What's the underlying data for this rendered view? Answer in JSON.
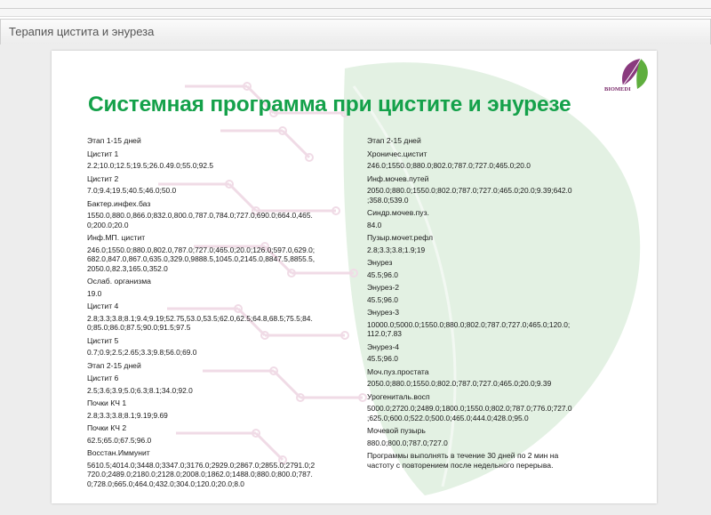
{
  "window": {
    "title": "Терапия цистита и энуреза"
  },
  "slide": {
    "brand": "BIOMEDI",
    "heading": "Системная программа при цистите и энурезе",
    "colors": {
      "heading": "#14a14a",
      "brand": "#7a2a6a",
      "leaf": "#e3f1e3",
      "circuit": "#f0dbe6"
    },
    "left_items": [
      {
        "label": "Этап 1-15 дней",
        "value": ""
      },
      {
        "label": "Цистит 1",
        "value": "2.2;10.0;12.5;19.5;26.0.49.0;55.0;92.5"
      },
      {
        "label": "Цистит 2",
        "value": "7.0;9.4;19.5;40.5;46.0;50.0"
      },
      {
        "label": "Бактер.инфех.баз",
        "value": "1550.0,880.0,866.0;832.0,800.0,787.0,784.0;727.0,690.0;664.0,465.\n0;200.0;20.0"
      },
      {
        "label": "Инф.МП. цистит",
        "value": "246.0;1550.0;880.0,802.0,787.0;727.0;465.0;20.0;126.0;597.0,629.0;\n682.0,847.0,867.0,635.0,329.0,9888.5,1045.0,2145.0,8847.5,8855.5,\n2050.0,82.3,165.0,352.0"
      },
      {
        "label": "Ослаб. организма",
        "value": "19.0"
      },
      {
        "label": "Цистит 4",
        "value": "2.8;3.3;3.8;8.1;9.4;9.19;52.75,53.0,53.5;62.0,62.5;64.8,68.5;75.5;84.\n0;85.0;86.0;87.5;90.0;91.5;97.5"
      },
      {
        "label": "Цистит 5",
        "value": "0.7;0.9;2.5;2.65;3.3;9.8;56.0;69.0"
      },
      {
        "label": "Этап 2-15 дней",
        "value": ""
      },
      {
        "label": "Цистит 6",
        "value": "2.5;3.6;3.9;5.0;6.3;8.1;34.0;92.0"
      },
      {
        "label": "Почки КЧ 1",
        "value": "2.8;3.3;3.8;8.1;9.19;9.69"
      },
      {
        "label": "Почки КЧ 2",
        "value": "62.5;65.0;67.5;96.0"
      },
      {
        "label": "Восстан.Иммунит",
        "value": "5610.5;4014.0;3448.0;3347.0;3176.0;2929.0;2867.0;2855.0;2791.0;2\n720.0;2489.0;2180.0;2128.0;2008.0;1862.0;1488.0;880.0;800.0;787.\n0;728.0;665.0;464.0;432.0;304.0;120.0;20.0;8.0"
      }
    ],
    "right_items": [
      {
        "label": "Этап 2-15 дней",
        "value": ""
      },
      {
        "label": "Хроничес.цистит",
        "value": "246.0;1550.0;880.0;802.0;787.0;727.0;465.0;20.0"
      },
      {
        "label": "Инф.мочев.путей",
        "value": "2050.0;880.0;1550.0;802.0;787.0;727.0;465.0;20.0;9.39;642.0\n;358.0;539.0"
      },
      {
        "label": "Синдр.мочев.пуз.",
        "value": "84.0"
      },
      {
        "label": "Пузыр.мочет.рефл",
        "value": "2.8;3.3;3.8;1.9;19"
      },
      {
        "label": "Энурез",
        "value": "45.5;96.0"
      },
      {
        "label": "Энурез-2",
        "value": "45.5;96.0"
      },
      {
        "label": "Энурез-3",
        "value": "10000.0;5000.0;1550.0;880.0;802.0;787.0;727.0;465.0;120.0;\n112.0;7.83"
      },
      {
        "label": "Энурез-4",
        "value": "45.5;96.0"
      },
      {
        "label": "Моч.пуз.простата",
        "value": "2050.0;880.0;1550.0;802.0;787.0;727.0;465.0;20.0;9.39"
      },
      {
        "label": "Урогениталь.восп",
        "value": "5000.0;2720.0;2489.0;1800.0;1550.0;802.0;787.0;776.0;727.0\n;625.0;600.0;522.0;500.0;465.0;444.0;428.0;95.0"
      },
      {
        "label": "Мочевой пузырь",
        "value": "880.0;800.0;787.0;727.0"
      },
      {
        "label": "Программы выполнять в течение 30 дней по 2 мин на\nчастоту с повторением после недельного перерыва.",
        "value": ""
      }
    ]
  }
}
